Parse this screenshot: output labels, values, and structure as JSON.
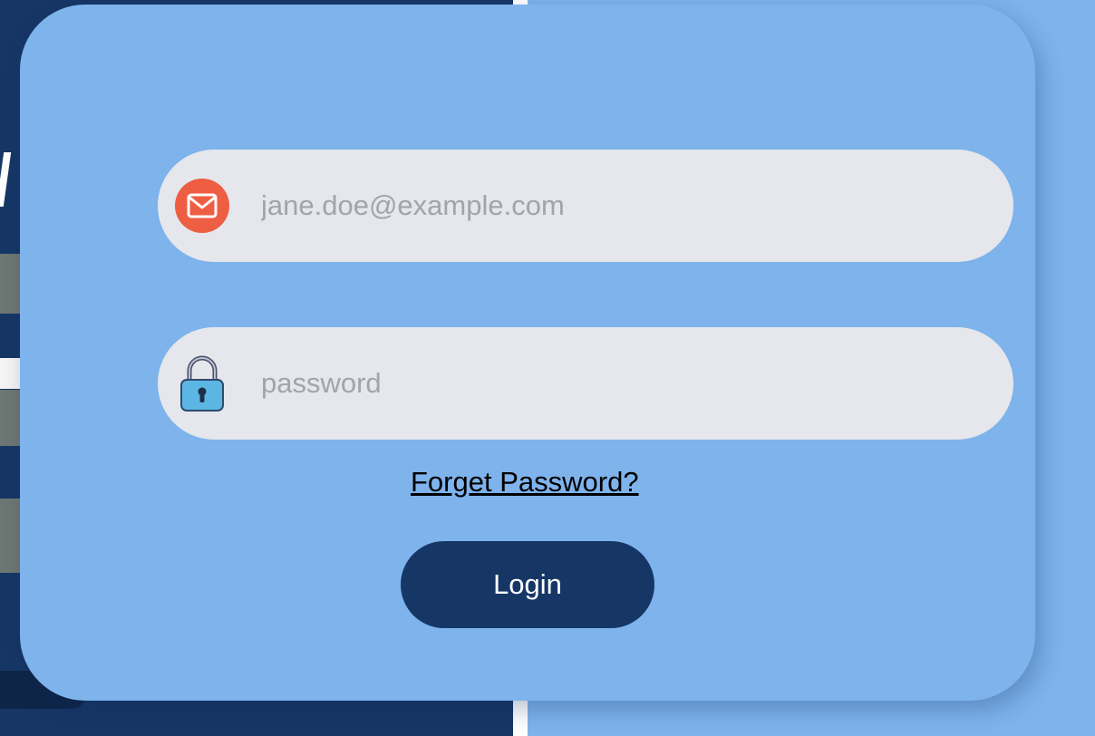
{
  "colors": {
    "background_left": "#163766",
    "card": "#7eb3ec",
    "field": "#e5e7ec",
    "button": "#163766",
    "mail_icon": "#ee5e43",
    "lock_body": "#5cb6e4"
  },
  "login_form": {
    "email": {
      "icon": "mail-icon",
      "placeholder": "jane.doe@example.com",
      "value": ""
    },
    "password": {
      "icon": "lock-icon",
      "placeholder": "password",
      "value": ""
    },
    "forgot_label": "Forget Password?",
    "login_label": "Login"
  }
}
